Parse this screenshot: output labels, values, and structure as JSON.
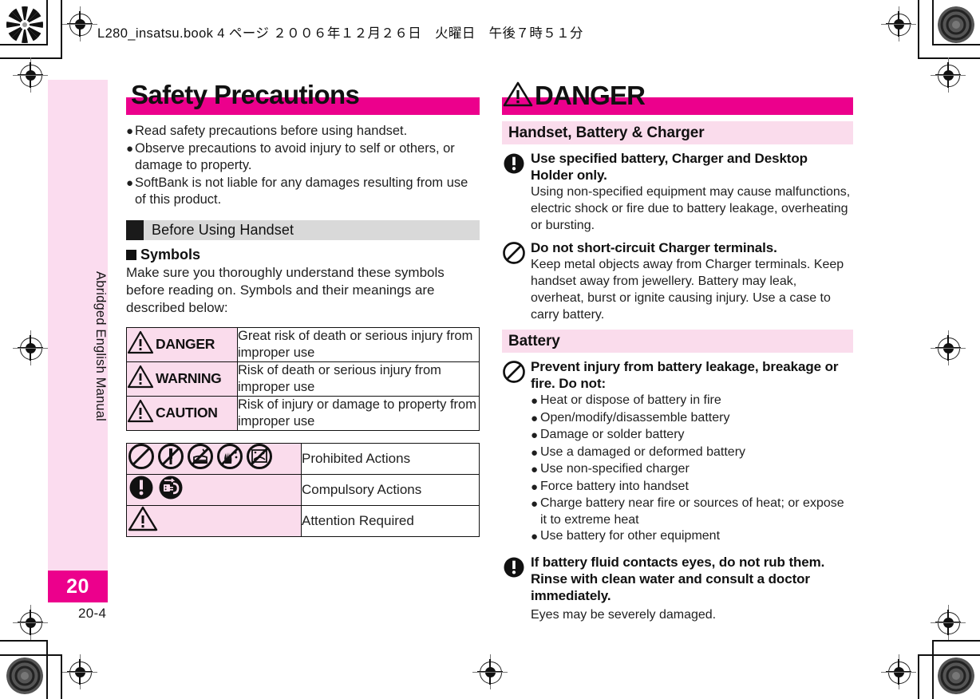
{
  "header": {
    "print_line": "L280_insatsu.book  4 ページ  ２００６年１２月２６日　火曜日　午後７時５１分"
  },
  "sidebar": {
    "label": "Abridged English Manual",
    "chapter_number": "20"
  },
  "folio": "20-4",
  "colors": {
    "magenta": "#ec008c",
    "pink_light": "#fbdcef",
    "pink_cell": "#fadcec",
    "gray_head": "#d9d9d9"
  },
  "left_column": {
    "title": "Safety Precautions",
    "intro_bullets": [
      "Read safety precautions before using handset.",
      "Observe precautions to avoid injury to self or others, or damage to property.",
      "SoftBank is not liable for any damages resulting from use of this product."
    ],
    "section_head": "Before Using Handset",
    "sub_head": "Symbols",
    "sub_paragraph": "Make sure you thoroughly understand these symbols before reading on. Symbols and their meanings are described below:",
    "symbol_table": {
      "rows": [
        {
          "icon": "warning-triangle-icon",
          "key": "DANGER",
          "value": "Great risk of death or serious injury from improper use"
        },
        {
          "icon": "warning-triangle-icon",
          "key": "WARNING",
          "value": "Risk of death or serious injury from improper use"
        },
        {
          "icon": "warning-triangle-icon",
          "key": "CAUTION",
          "value": "Risk of injury or damage to property from improper use"
        }
      ]
    },
    "action_table": {
      "rows": [
        {
          "icons": [
            "prohibition-general-icon",
            "no-disassembly-icon",
            "no-bath-fire-icon",
            "no-wet-hands-icon",
            "no-liquids-icon"
          ],
          "label": "Prohibited Actions"
        },
        {
          "icons": [
            "compulsory-exclamation-icon",
            "unplug-from-outlet-icon"
          ],
          "label": "Compulsory Actions"
        },
        {
          "icons": [
            "warning-triangle-icon"
          ],
          "label": "Attention Required"
        }
      ]
    }
  },
  "right_column": {
    "title": "DANGER",
    "title_icon": "warning-triangle-icon",
    "sections": [
      {
        "heading": "Handset, Battery & Charger",
        "blocks": [
          {
            "icon": "compulsory-exclamation-icon",
            "title": "Use specified battery, Charger and Desktop Holder only.",
            "text": "Using non-specified equipment may cause malfunctions, electric shock or fire due to battery leakage, overheating or bursting.",
            "bullets": []
          },
          {
            "icon": "prohibition-general-icon",
            "title": "Do not short-circuit Charger terminals.",
            "text": "Keep metal objects away from Charger terminals. Keep handset away from jewellery. Battery may leak, overheat, burst or ignite causing injury. Use a case to carry battery.",
            "bullets": []
          }
        ]
      },
      {
        "heading": "Battery",
        "blocks": [
          {
            "icon": "prohibition-general-icon",
            "title": "Prevent injury from battery leakage, breakage or fire. Do not:",
            "text": "",
            "bullets": [
              "Heat or dispose of battery in fire",
              "Open/modify/disassemble battery",
              "Damage or solder battery",
              "Use a damaged or deformed battery",
              "Use non-specified charger",
              "Force battery into handset",
              "Charge battery near fire or sources of heat; or expose it to extreme heat",
              "Use battery for other equipment"
            ]
          },
          {
            "icon": "compulsory-exclamation-icon",
            "title": "If battery fluid contacts eyes, do not rub them. Rinse with clean water and consult a doctor immediately.",
            "text": "Eyes may be severely damaged.",
            "bullets": []
          }
        ]
      }
    ]
  }
}
